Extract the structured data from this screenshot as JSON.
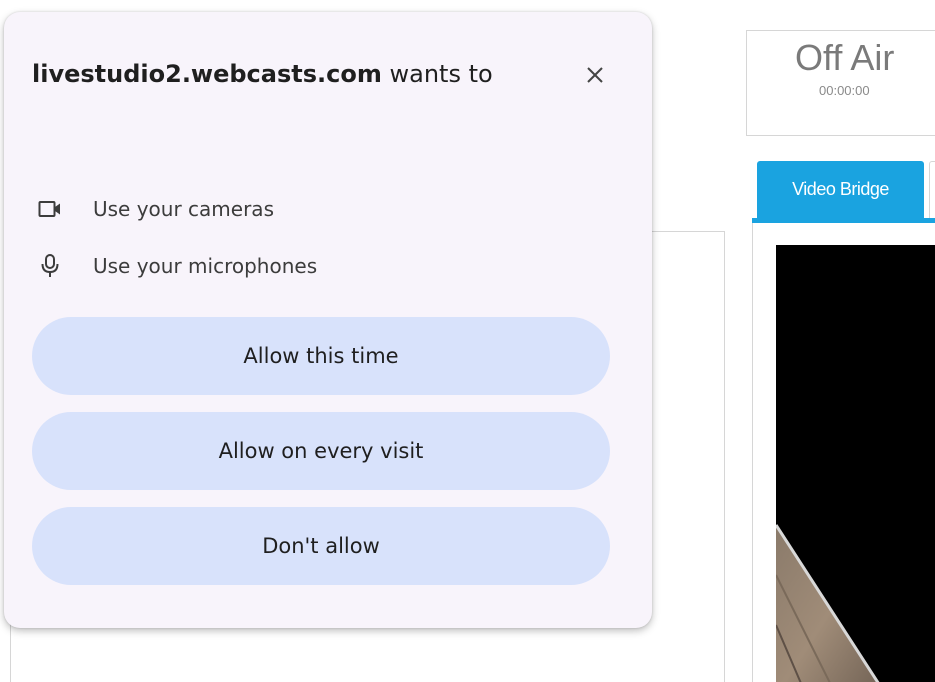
{
  "popup": {
    "origin": "livestudio2.webcasts.com",
    "title_suffix": " wants to",
    "close_glyph": "✕",
    "permissions": [
      {
        "icon": "camera-icon",
        "label": "Use your cameras"
      },
      {
        "icon": "microphone-icon",
        "label": "Use your microphones"
      }
    ],
    "buttons": {
      "allow_this_time": "Allow this time",
      "allow_every_visit": "Allow on every visit",
      "dont_allow": "Don't allow"
    }
  },
  "broadcast_status": {
    "label": "Off Air",
    "timer": "00:00:00"
  },
  "tabs": {
    "active": "Video Bridge"
  },
  "colors": {
    "popup_bg": "#f8f4fb",
    "button_bg": "#d8e2fb",
    "tab_accent": "#1aa3e0"
  }
}
